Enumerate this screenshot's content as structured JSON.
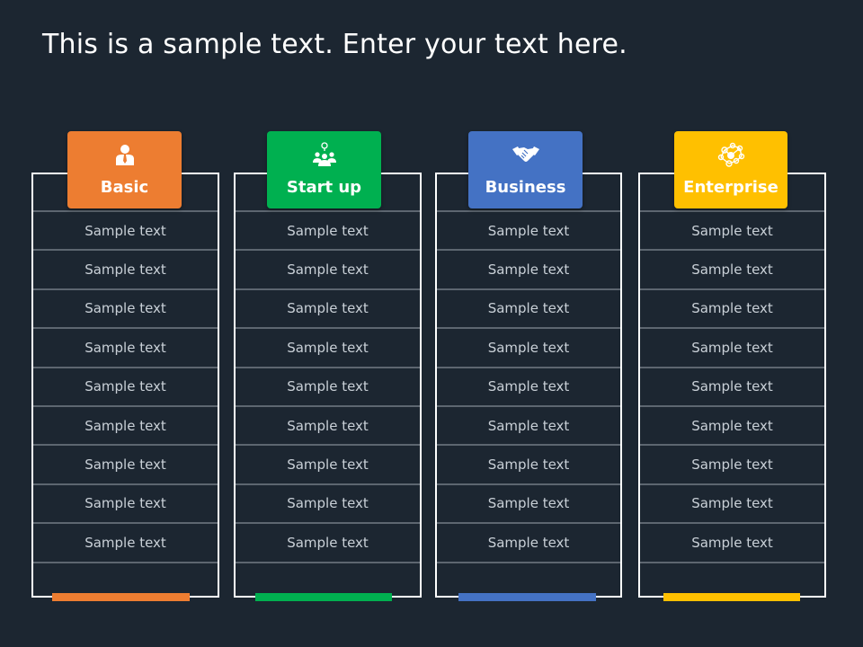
{
  "title": "This is a sample text. Enter your text here.",
  "plans": [
    {
      "name": "Basic",
      "icon": "businessman-icon",
      "color": "#ed7d31",
      "rows": [
        "Sample text",
        "Sample text",
        "Sample text",
        "Sample text",
        "Sample text",
        "Sample text",
        "Sample text",
        "Sample text",
        "Sample text",
        ""
      ]
    },
    {
      "name": "Start up",
      "icon": "team-lightbulb-icon",
      "color": "#00b050",
      "rows": [
        "Sample text",
        "Sample text",
        "Sample text",
        "Sample text",
        "Sample text",
        "Sample text",
        "Sample text",
        "Sample text",
        "Sample text",
        ""
      ]
    },
    {
      "name": "Business",
      "icon": "handshake-icon",
      "color": "#4472c4",
      "rows": [
        "Sample text",
        "Sample text",
        "Sample text",
        "Sample text",
        "Sample text",
        "Sample text",
        "Sample text",
        "Sample text",
        "Sample text",
        ""
      ]
    },
    {
      "name": "Enterprise",
      "icon": "network-icon",
      "color": "#ffc000",
      "rows": [
        "Sample text",
        "Sample text",
        "Sample text",
        "Sample text",
        "Sample text",
        "Sample text",
        "Sample text",
        "Sample text",
        "Sample text",
        ""
      ]
    }
  ]
}
